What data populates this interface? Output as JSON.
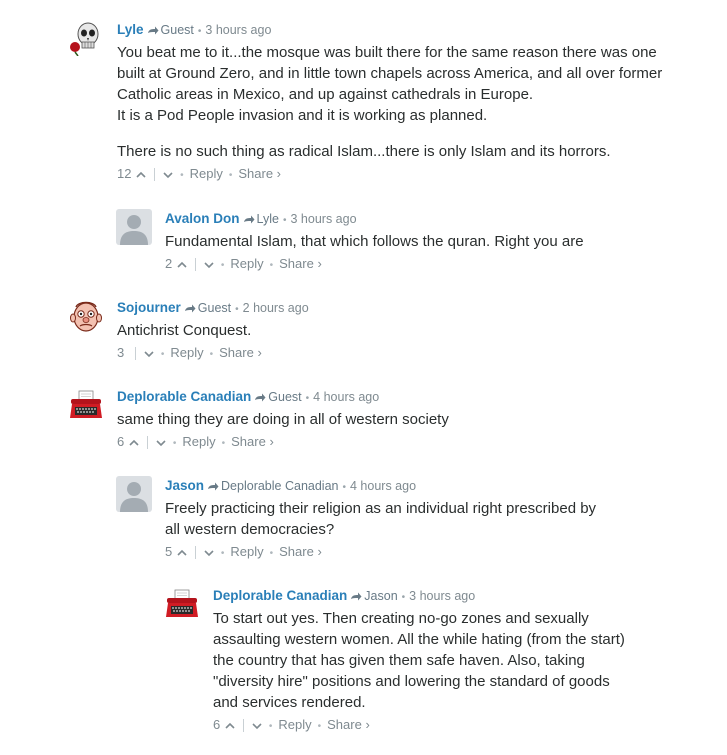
{
  "comments": [
    {
      "author": "Lyle",
      "parent": "Guest",
      "time": "3 hours ago",
      "avatar": "skull-rose-avatar",
      "paragraphs": [
        "You beat me to it...the mosque was built there for the same reason there was one built at Ground Zero, and in little town chapels across America, and all over former Catholic areas in Mexico, and up against cathedrals in Europe.\nIt is a Pod People invasion and it is working as planned.",
        "There is no such thing as radical Islam...there is only Islam and its horrors."
      ],
      "votes": "12",
      "reply_label": "Reply",
      "share_label": "Share ›"
    },
    {
      "author": "Avalon Don",
      "parent": "Lyle",
      "time": "3 hours ago",
      "avatar": "default-avatar",
      "paragraphs": [
        "Fundamental Islam, that which follows the quran. Right you are"
      ],
      "votes": "2",
      "reply_label": "Reply",
      "share_label": "Share ›"
    },
    {
      "author": "Sojourner",
      "parent": "Guest",
      "time": "2 hours ago",
      "avatar": "cartoon-face-avatar",
      "paragraphs": [
        "Antichrist Conquest."
      ],
      "votes": "3",
      "reply_label": "Reply",
      "share_label": "Share ›"
    },
    {
      "author": "Deplorable Canadian",
      "parent": "Guest",
      "time": "4 hours ago",
      "avatar": "typewriter-avatar",
      "paragraphs": [
        "same thing they are doing in all of western society"
      ],
      "votes": "6",
      "reply_label": "Reply",
      "share_label": "Share ›"
    },
    {
      "author": "Jason",
      "parent": "Deplorable Canadian",
      "time": "4 hours ago",
      "avatar": "default-avatar",
      "paragraphs": [
        "Freely practicing their religion as an individual right prescribed by all western democracies?"
      ],
      "votes": "5",
      "reply_label": "Reply",
      "share_label": "Share ›"
    },
    {
      "author": "Deplorable Canadian",
      "parent": "Jason",
      "time": "3 hours ago",
      "avatar": "typewriter-avatar",
      "paragraphs": [
        "To start out yes. Then creating no-go zones and sexually assaulting western women. All the while hating (from the start) the country that has given them safe haven. Also, taking \"diversity hire\" positions and lowering the standard of goods and services rendered."
      ],
      "votes": "6",
      "reply_label": "Reply",
      "share_label": "Share ›"
    }
  ]
}
